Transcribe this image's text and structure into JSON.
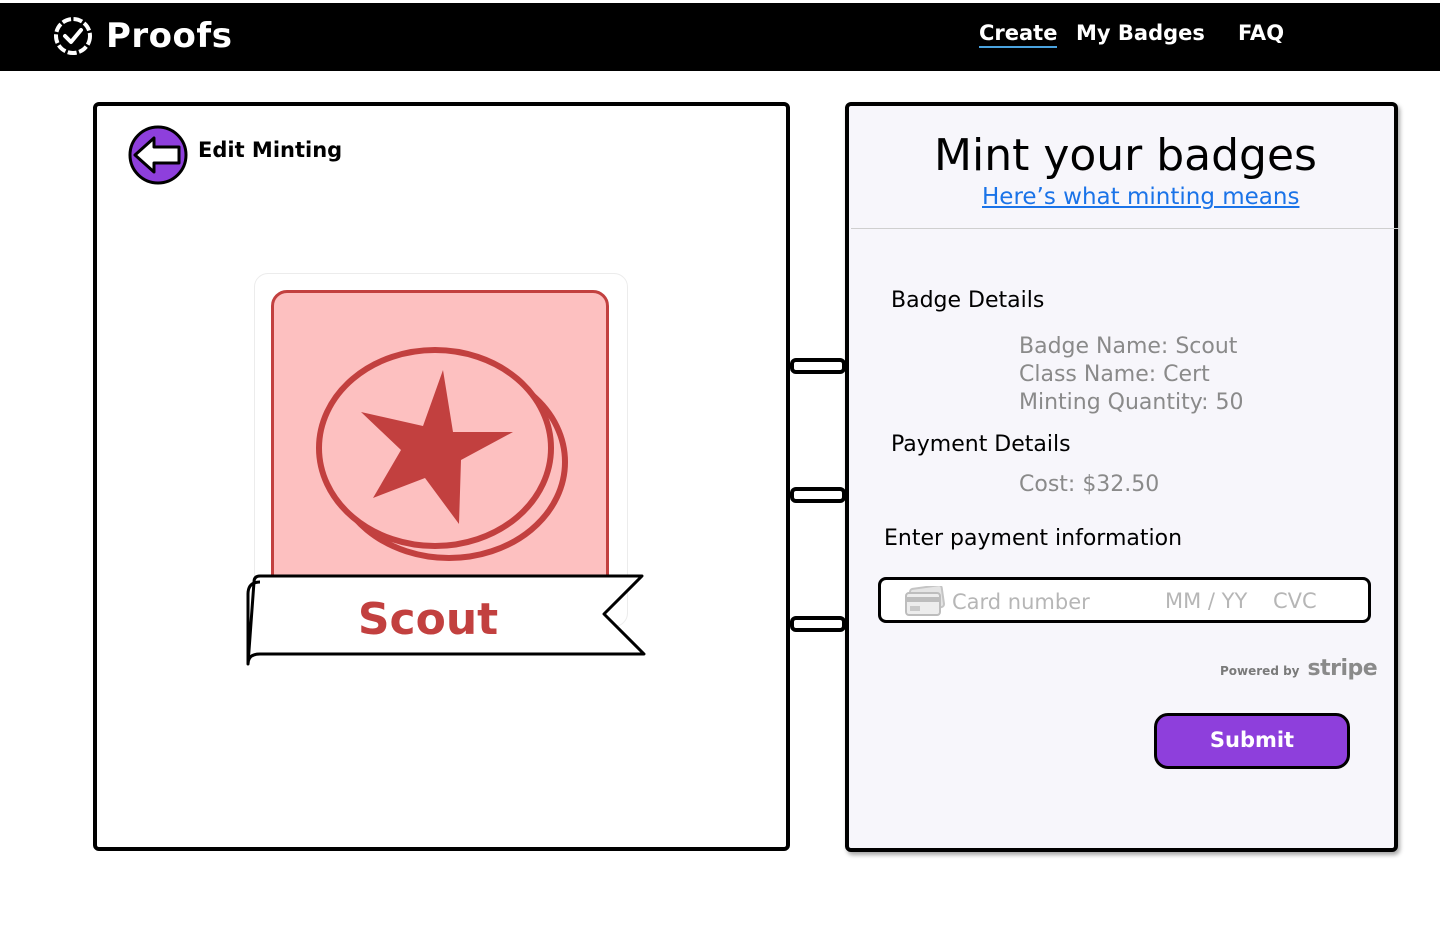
{
  "app": {
    "logo_text": "Proofs",
    "logo_icon": "check-circle-icon"
  },
  "nav": {
    "create": "Create",
    "my_badges": "My Badges",
    "faq": "FAQ",
    "active": "Create"
  },
  "left": {
    "back_icon": "arrow-left-icon",
    "back_label": "Edit Minting",
    "badge": {
      "name": "Scout",
      "icon": "star-coin-icon",
      "bg_color": "#fdc0c0",
      "accent_color": "#c2403f"
    }
  },
  "right": {
    "title": "Mint your badges",
    "info_link": "Here’s what minting means",
    "badge_details_heading": "Badge Details",
    "badge_name": "Badge Name: Scout",
    "class_name": "Class Name: Cert",
    "minting_quantity": "Minting Quantity: 50",
    "payment_details_heading": "Payment Details",
    "cost": "Cost: $32.50",
    "payment_info_heading": "Enter payment information",
    "card": {
      "icon": "credit-card-icon",
      "number_placeholder": "Card number",
      "expiry_placeholder": "MM / YY",
      "cvc_placeholder": "CVC"
    },
    "powered_by": "Powered by",
    "provider": "stripe",
    "submit": "Submit"
  },
  "colors": {
    "primary": "#8e3fdc",
    "link": "#1a73e8",
    "header_bg": "#000000",
    "panel_bg": "#f7f6fb"
  }
}
